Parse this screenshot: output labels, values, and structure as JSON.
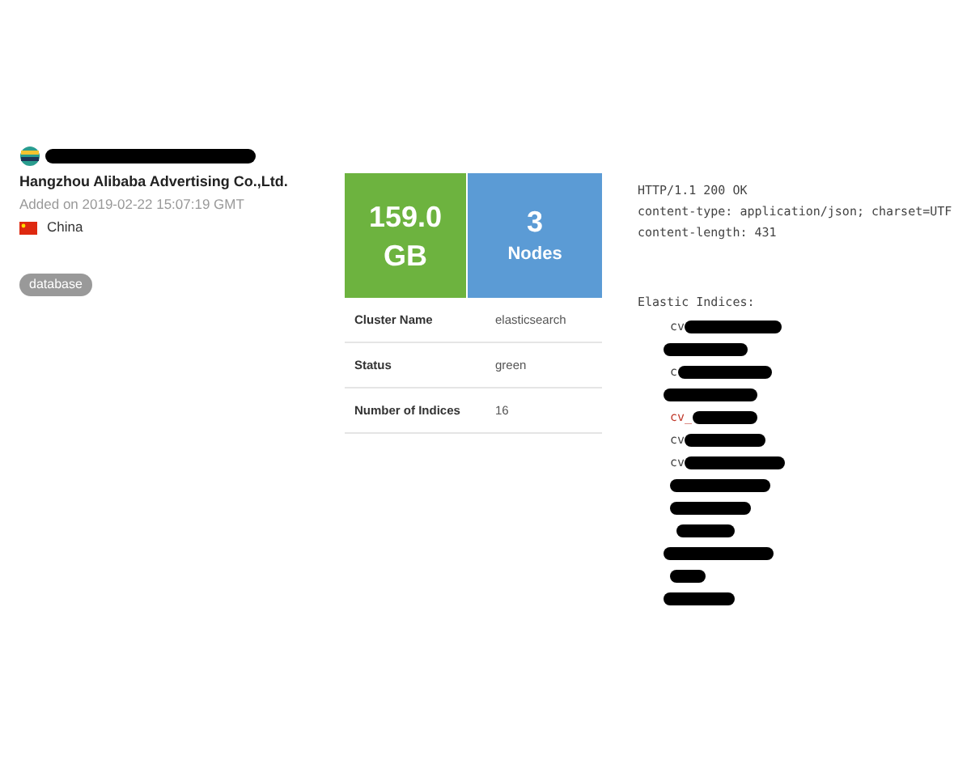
{
  "host": {
    "organization": "Hangzhou Alibaba Advertising Co.,Ltd.",
    "added": "Added on 2019-02-22 15:07:19 GMT",
    "country": "China",
    "tags": [
      "database"
    ]
  },
  "stats": [
    {
      "value": "159.0 GB",
      "color": "#6db33f"
    },
    {
      "value": "3",
      "label": "Nodes",
      "color": "#5b9bd5"
    }
  ],
  "details": [
    {
      "name": "Cluster Name",
      "value": "elasticsearch"
    },
    {
      "name": "Status",
      "value": "green"
    },
    {
      "name": "Number of Indices",
      "value": "16"
    }
  ],
  "response": {
    "headers": [
      "HTTP/1.1 200 OK",
      "content-type: application/json; charset=UTF",
      "content-length: 431"
    ],
    "indices_title": "Elastic Indices:",
    "indices": [
      {
        "kind": "partial",
        "text": "cv",
        "highlighted": false
      },
      {
        "kind": "redacted"
      },
      {
        "kind": "partial",
        "text": "c",
        "highlighted": false
      },
      {
        "kind": "redacted"
      },
      {
        "kind": "partial",
        "text": "cv_",
        "highlighted": true
      },
      {
        "kind": "partial",
        "text": "cv",
        "highlighted": false
      },
      {
        "kind": "partial",
        "text": "cv",
        "highlighted": false
      },
      {
        "kind": "redacted"
      },
      {
        "kind": "redacted"
      },
      {
        "kind": "redacted"
      },
      {
        "kind": "redacted"
      },
      {
        "kind": "redacted"
      },
      {
        "kind": "redacted"
      }
    ]
  }
}
